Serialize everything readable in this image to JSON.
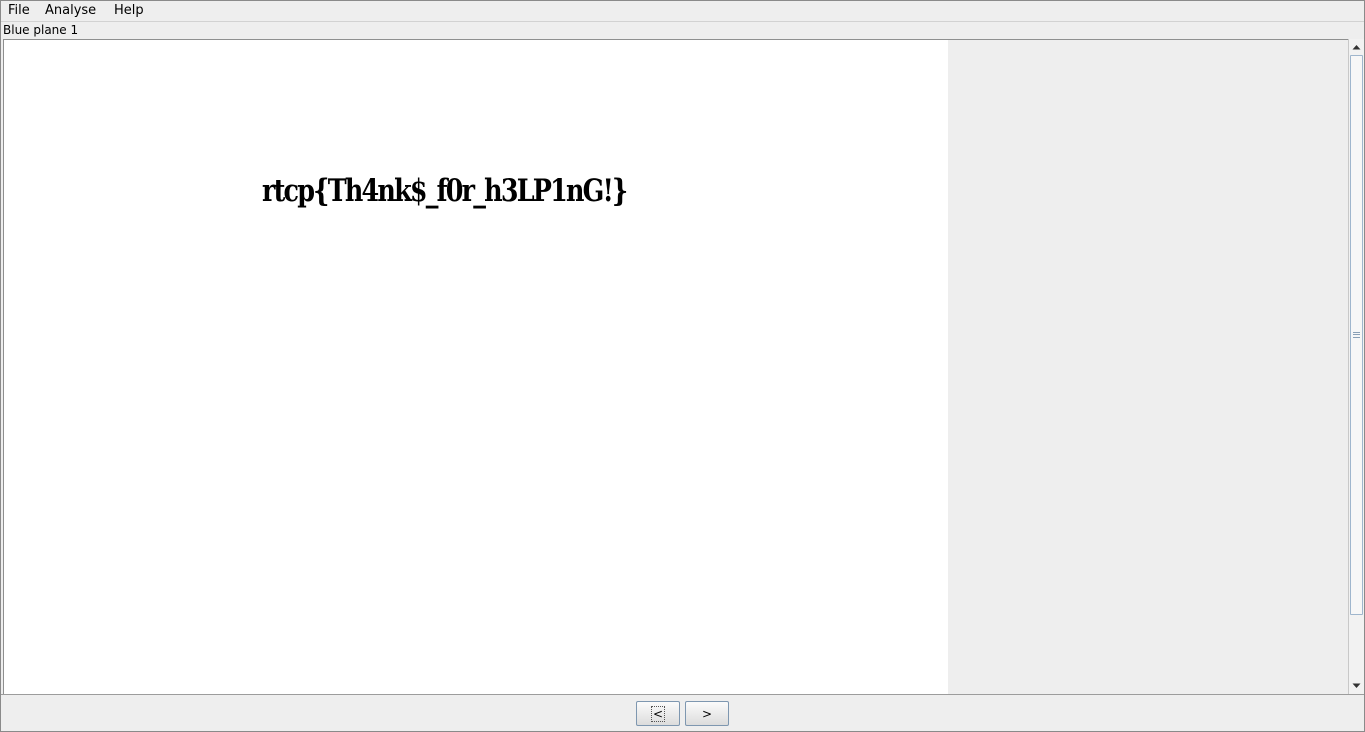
{
  "menubar": {
    "items": [
      "File",
      "Analyse",
      "Help"
    ]
  },
  "window": {
    "title": "Blue plane 1"
  },
  "image": {
    "decoded_text": "rtcp{Th4nk$_f0r_h3LP1nG!}"
  },
  "navigation": {
    "prev_label": "<",
    "next_label": ">"
  },
  "colors": {
    "canvas": "#ffffff",
    "background": "#eeeeee",
    "text": "#000000",
    "accent": "#9fb6cd"
  }
}
